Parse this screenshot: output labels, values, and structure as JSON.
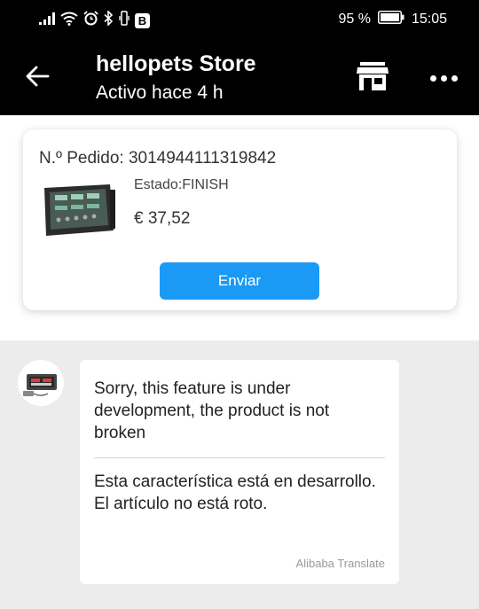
{
  "status_bar": {
    "battery_text": "95 %",
    "time": "15:05",
    "b_badge": "B"
  },
  "header": {
    "store_name": "hellopets Store",
    "store_status": "Activo hace 4 h"
  },
  "order": {
    "number": "N.º Pedido: 3014944111319842",
    "state": "Estado:FINISH",
    "price": "€ 37,52",
    "send_label": "Enviar"
  },
  "message": {
    "original": "Sorry, this feature is under development, the product is not broken",
    "translated": "Esta característica está en desarrollo. El artículo no está roto.",
    "translator": "Alibaba Translate"
  },
  "colors": {
    "send_button": "#1a9af5",
    "header_bg": "#000000",
    "chat_bg": "#ececec"
  }
}
